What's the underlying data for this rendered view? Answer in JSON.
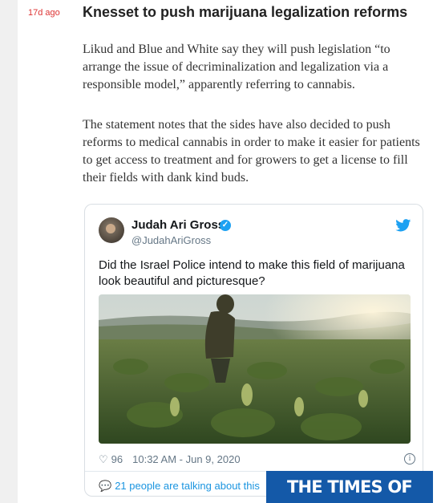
{
  "post": {
    "time": "17d ago",
    "headline": "Knesset to push marijuana legalization reforms",
    "paragraph1": "Likud and Blue and White say they will push legislation “to arrange the issue of decriminalization and legalization via a responsible model,” apparently referring to cannabis.",
    "paragraph2": "The statement notes that the sides have also decided to push reforms to medical cannabis in order to make it easier for patients to get access to treatment and for growers to get a license to fill their fields with dank kind buds."
  },
  "tweet": {
    "author": "Judah Ari Gross",
    "handle": "@JudahAriGross",
    "text": "Did the Israel Police intend to make this field of marijuana look beautiful and picturesque?",
    "likes": "96",
    "timestamp": "10:32 AM - Jun 9, 2020",
    "talking": "21 people are talking about this",
    "icons": [
      "avatar",
      "verified-icon",
      "twitter-bird-icon",
      "heart-icon",
      "info-icon",
      "comment-bubble-icon"
    ],
    "accent_color": "#1da1f2"
  },
  "watermark": {
    "text": "THE TIMES OF ISRAEL",
    "bg_color": "#1459a8"
  }
}
